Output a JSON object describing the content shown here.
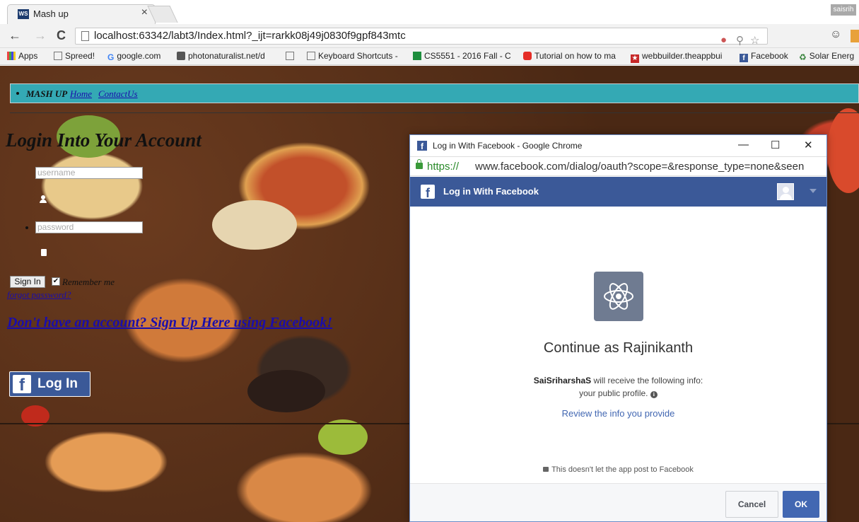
{
  "browser": {
    "tab_favicon": "WS",
    "tab_title": "Mash up",
    "tab_close": "×",
    "profile": "saisrih",
    "url": "localhost:63342/labt3/Index.html?_ijt=rarkk08j49j0830f9gpf843mtc",
    "back_icon": "←",
    "forward_icon": "→",
    "reload_icon": "C"
  },
  "bookmarks": [
    {
      "label": "Apps",
      "icon": "apps-grid-icon"
    },
    {
      "label": "Spreed!",
      "icon": "page-icon"
    },
    {
      "label": "google.com",
      "icon": "google-icon"
    },
    {
      "label": "photonaturalist.net/d",
      "icon": "camera-icon"
    },
    {
      "label": "",
      "icon": "page-icon"
    },
    {
      "label": "Keyboard Shortcuts -",
      "icon": "page-icon"
    },
    {
      "label": "CS5551 - 2016 Fall - C",
      "icon": "sheet-icon"
    },
    {
      "label": "Tutorial on how to ma",
      "icon": "youtube-icon"
    },
    {
      "label": "webbuilder.theappbui",
      "icon": "star-icon"
    },
    {
      "label": "Facebook",
      "icon": "facebook-icon"
    },
    {
      "label": "Solar Energ",
      "icon": "recycle-icon"
    }
  ],
  "site": {
    "brand": "MASH UP",
    "nav_home": "Home",
    "nav_contact": "ContactUs",
    "login_title": "Login Into Your Account",
    "username_placeholder": "username",
    "password_placeholder": "password",
    "signin": "Sign In",
    "remember": "Remember me",
    "forgot": "forgot password?",
    "signup": "Don't have an account? Sign Up Here using Facebook!",
    "fb_login": "Log In",
    "fb_f": "f"
  },
  "popup": {
    "window_title": "Log in With Facebook - Google Chrome",
    "url_scheme": "https://",
    "url_rest": "www.facebook.com/dialog/oauth?scope=&response_type=none&seen",
    "header": "Log in With Facebook",
    "continue": "Continue as Rajinikanth",
    "app_name": "SaiSriharshaS",
    "info_rest": " will receive the following info:",
    "info_line2": "your public profile.",
    "review": "Review the info you provide",
    "no_post": "This doesn't let the app post to Facebook",
    "cancel": "Cancel",
    "ok": "OK",
    "minimize": "—",
    "maximize": "☐",
    "close": "✕"
  },
  "colors": {
    "navbar": "#34a9b4",
    "facebook_blue": "#3b5998",
    "ok_blue": "#4267b2"
  }
}
